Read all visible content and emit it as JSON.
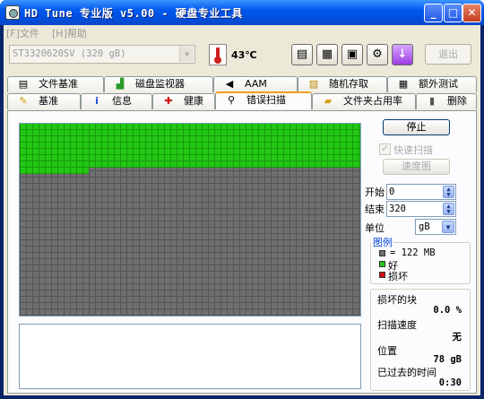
{
  "window": {
    "title": "HD Tune 专业版 v5.00 - 硬盘专业工具"
  },
  "menu": {
    "file": "[F]文件",
    "help": "[H]帮助"
  },
  "toolbar": {
    "drive": "ST3320620SV (320 gB)",
    "temperature": "43℃",
    "exit_label": "退出",
    "buttons": [
      "copy-text-icon",
      "copy-screenshot-icon",
      "save-icon",
      "options-icon",
      "download-icon"
    ]
  },
  "tabs_row1": [
    {
      "label": "文件基准",
      "icon": "file-benchmark-icon"
    },
    {
      "label": "磁盘监视器",
      "icon": "disk-monitor-icon"
    },
    {
      "label": "AAM",
      "icon": "speaker-icon"
    },
    {
      "label": "随机存取",
      "icon": "random-access-icon"
    },
    {
      "label": "额外测试",
      "icon": "extra-tests-icon"
    }
  ],
  "tabs_row2": [
    {
      "label": "基准",
      "icon": "benchmark-icon"
    },
    {
      "label": "信息",
      "icon": "info-icon"
    },
    {
      "label": "健康",
      "icon": "health-cross-icon"
    },
    {
      "label": "错误扫描",
      "icon": "magnifier-icon",
      "active": true
    },
    {
      "label": "文件夹占用率",
      "icon": "folder-icon"
    },
    {
      "label": "删除",
      "icon": "trash-icon"
    }
  ],
  "scan": {
    "progress_fraction": 0.24,
    "stop_label": "停止",
    "quick_scan_label": "快速扫描",
    "quick_scan_checked": true,
    "speed_map_label": "速度图",
    "start_label": "开始",
    "start_value": "0",
    "end_label": "结束",
    "end_value": "320",
    "unit_label": "单位",
    "unit_value": "gB"
  },
  "legend": {
    "title": "图例",
    "block_size": "= 122 MB",
    "good_label": "好",
    "bad_label": "损坏",
    "colors": {
      "unscanned": "#6f6f6f",
      "good": "#22c814",
      "bad": "#d01010"
    }
  },
  "stats": {
    "damaged_label": "损坏的块",
    "damaged_value": "0.0 %",
    "speed_label": "扫描速度",
    "speed_value": "无",
    "position_label": "位置",
    "position_value": "78 gB",
    "elapsed_label": "已过去的时间",
    "elapsed_value": "0:30"
  }
}
